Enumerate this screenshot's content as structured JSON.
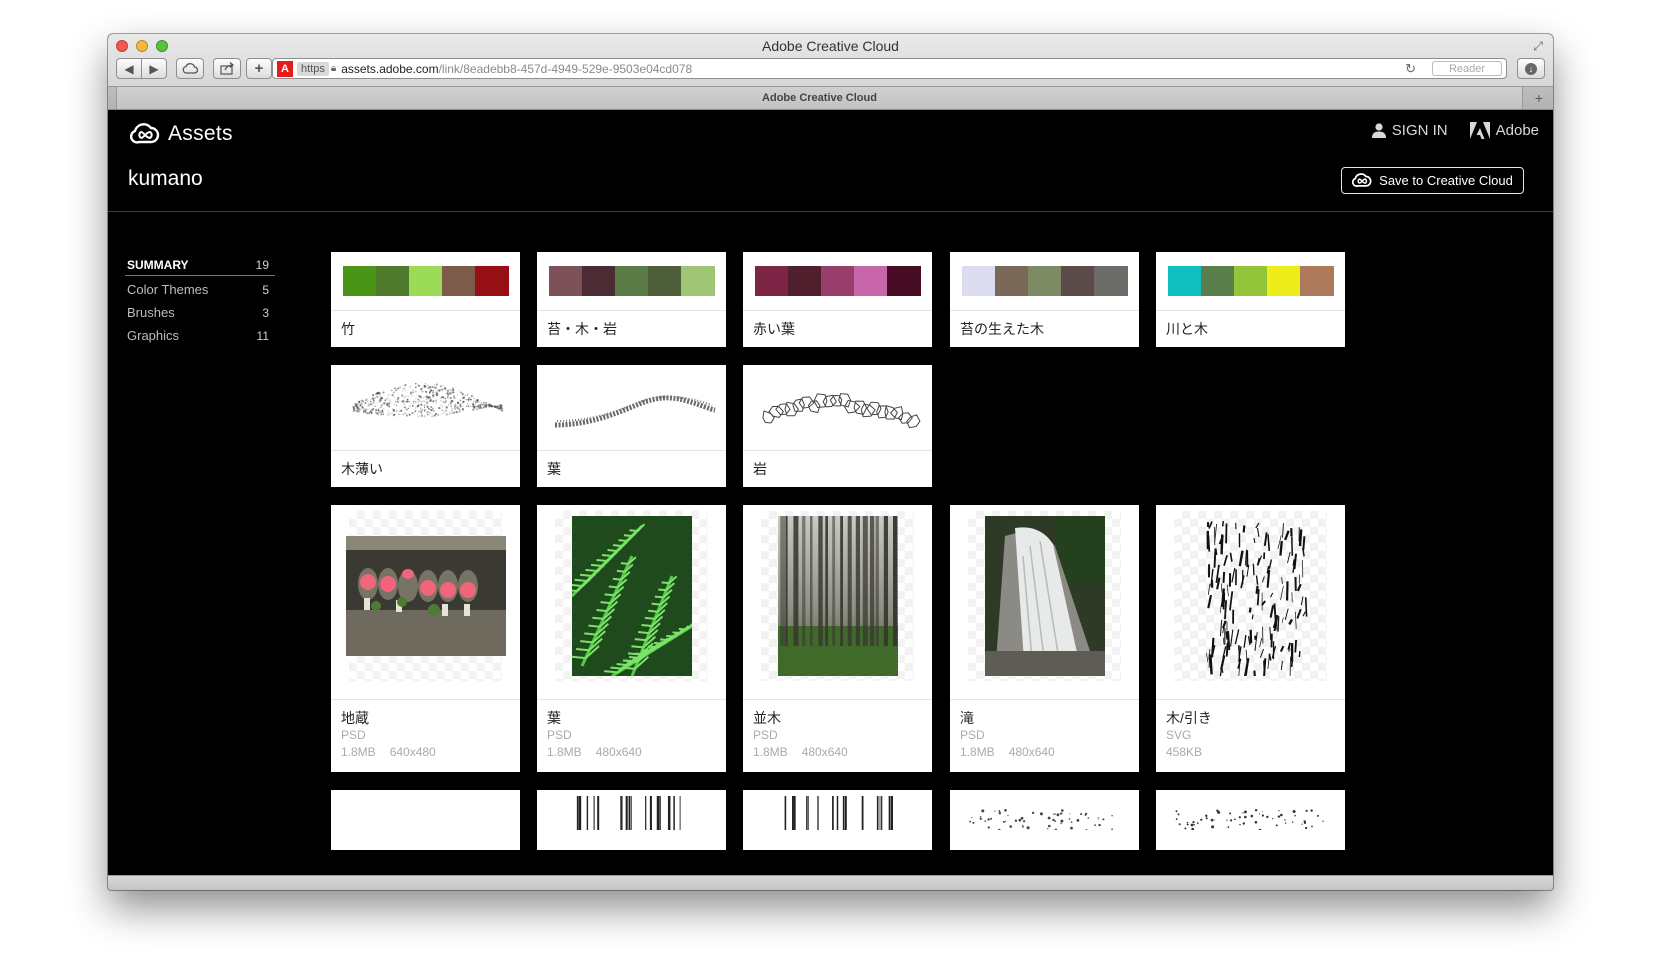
{
  "browser": {
    "window_title": "Adobe Creative Cloud",
    "tab_title": "Adobe Creative Cloud",
    "url_scheme": "https",
    "url_host": "assets.adobe.com",
    "url_path": "/link/8eadebb8-457d-4949-529e-9503e04cd078",
    "reader_label": "Reader"
  },
  "header": {
    "brand": "Assets",
    "sign_in": "SIGN IN",
    "adobe": "Adobe",
    "folder_title": "kumano",
    "save_button": "Save to Creative Cloud"
  },
  "sidebar": {
    "items": [
      {
        "label": "SUMMARY",
        "count": "19"
      },
      {
        "label": "Color Themes",
        "count": "5"
      },
      {
        "label": "Brushes",
        "count": "3"
      },
      {
        "label": "Graphics",
        "count": "11"
      }
    ]
  },
  "themes": [
    {
      "title": "竹",
      "colors": [
        "#4a9418",
        "#4f7a2c",
        "#9bdb58",
        "#7d5b4a",
        "#960f14"
      ]
    },
    {
      "title": "苔・木・岩",
      "colors": [
        "#7c5158",
        "#4b2b34",
        "#5b7c47",
        "#4e5e38",
        "#9fc574"
      ]
    },
    {
      "title": "赤い葉",
      "colors": [
        "#7d2544",
        "#4f1f2d",
        "#983e6b",
        "#c766a8",
        "#470d24"
      ]
    },
    {
      "title": "苔の生えた木",
      "colors": [
        "#dcdcf1",
        "#7a6859",
        "#7d8a63",
        "#5b4b4a",
        "#6b6c68"
      ]
    },
    {
      "title": "川と木",
      "colors": [
        "#10c0c0",
        "#5b7f4c",
        "#94c43a",
        "#eded1b",
        "#ad7a5b"
      ]
    }
  ],
  "brushes": [
    {
      "title": "木薄い",
      "style": "cloud"
    },
    {
      "title": "葉",
      "style": "wave"
    },
    {
      "title": "岩",
      "style": "rocks"
    }
  ],
  "graphics": [
    {
      "title": "地蔵",
      "type": "PSD",
      "size": "1.8MB",
      "dimensions": "640x480",
      "thumb": "jizo"
    },
    {
      "title": "葉",
      "type": "PSD",
      "size": "1.8MB",
      "dimensions": "480x640",
      "thumb": "fern"
    },
    {
      "title": "並木",
      "type": "PSD",
      "size": "1.8MB",
      "dimensions": "480x640",
      "thumb": "forest"
    },
    {
      "title": "滝",
      "type": "PSD",
      "size": "1.8MB",
      "dimensions": "480x640",
      "thumb": "waterfall"
    },
    {
      "title": "木/引き",
      "type": "SVG",
      "size": "458KB",
      "dimensions": "",
      "thumb": "sketch"
    }
  ]
}
